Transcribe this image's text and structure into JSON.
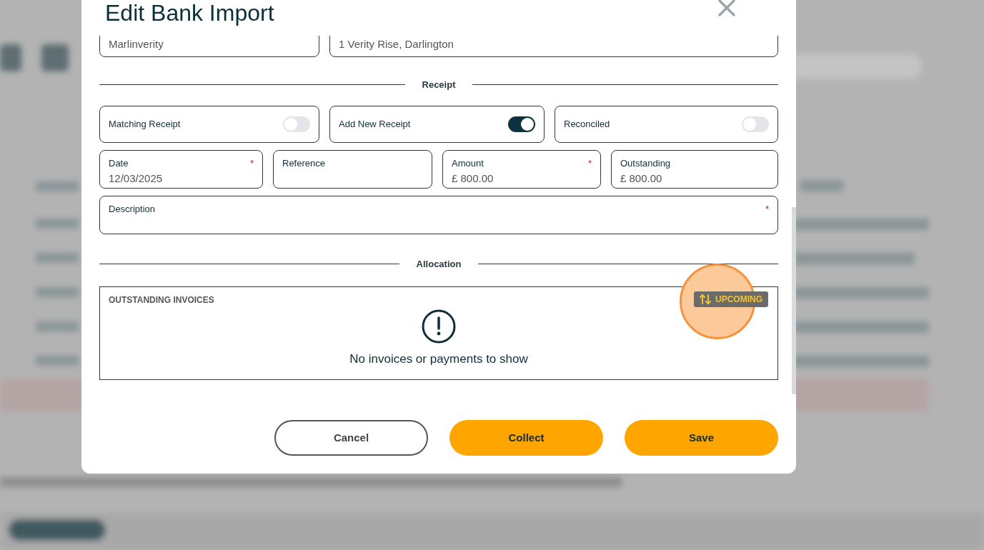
{
  "dialog": {
    "title": "Edit Bank Import"
  },
  "partial_fields": [
    {
      "value": "Marlinverity"
    },
    {
      "value": "1 Verity Rise, Darlington"
    }
  ],
  "receipt_heading": "Receipt",
  "toggles": [
    {
      "label": "Matching Receipt",
      "on": false
    },
    {
      "label": "Add New Receipt",
      "on": true
    },
    {
      "label": "Reconciled",
      "on": false
    }
  ],
  "fields": [
    {
      "label": "Date",
      "value": "12/03/2025",
      "marker": "*"
    },
    {
      "label": "Reference"
    },
    {
      "label": "Amount",
      "value": "£ 800.00",
      "marker": "*"
    },
    {
      "label": "Outstanding",
      "value": "£ 800.00"
    }
  ],
  "description": {
    "label": "Description",
    "marker": "*"
  },
  "allocation_heading": "Allocation",
  "invoices": {
    "title": "OUTSTANDING INVOICES",
    "badge": "UPCOMING",
    "empty_message": "No invoices or payments to show"
  },
  "buttons": [
    {
      "label": "Cancel",
      "kind": "outline"
    },
    {
      "label": "Collect",
      "kind": "primary"
    },
    {
      "label": "Save",
      "kind": "primary"
    }
  ]
}
